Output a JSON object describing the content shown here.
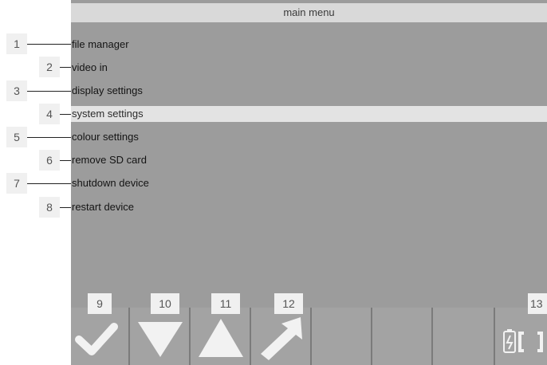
{
  "screen": {
    "title": "main menu"
  },
  "menu": {
    "items": [
      {
        "label": "file manager"
      },
      {
        "label": "video in"
      },
      {
        "label": "display settings"
      },
      {
        "label": "system settings"
      },
      {
        "label": "colour settings"
      },
      {
        "label": "remove SD card"
      },
      {
        "label": "shutdown device"
      },
      {
        "label": "restart device"
      }
    ],
    "selected": "system settings"
  },
  "toolbar": {
    "buttons": [
      {
        "icon": "checkmark-icon"
      },
      {
        "icon": "arrow-down-icon"
      },
      {
        "icon": "arrow-up-icon"
      },
      {
        "icon": "diagonal-arrow-icon"
      },
      {
        "icon": ""
      },
      {
        "icon": ""
      },
      {
        "icon": ""
      },
      {
        "icon": "battery-fullscreen-icon"
      }
    ]
  },
  "callouts": [
    "1",
    "2",
    "3",
    "4",
    "5",
    "6",
    "7",
    "8",
    "9",
    "10",
    "11",
    "12",
    "13"
  ],
  "colors": {
    "screen_bg": "#9c9c9c",
    "title_bar_bg": "#d9d9d9",
    "selected_row_bg": "#e3e3e3",
    "icon_color": "#f2f2f2",
    "callout_bg": "#f0f0f0"
  }
}
